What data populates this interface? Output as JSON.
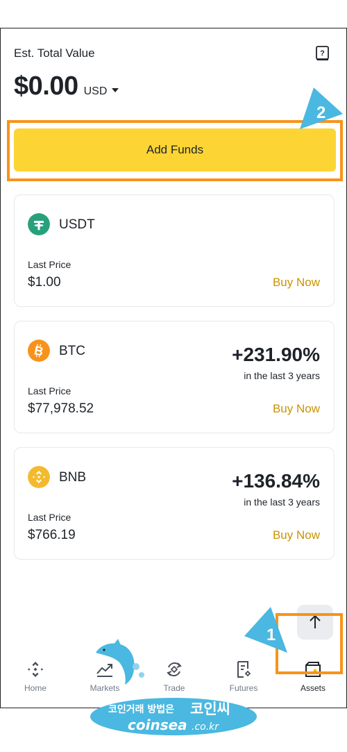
{
  "header": {
    "est_label": "Est. Total Value",
    "total_value": "$0.00",
    "currency": "USD"
  },
  "add_funds_label": "Add Funds",
  "coins": [
    {
      "name": "USDT",
      "last_label": "Last Price",
      "price": "$1.00",
      "buy_label": "Buy Now",
      "color": "#26a17b"
    },
    {
      "name": "BTC",
      "pct": "+231.90%",
      "pct_sub": "in the last 3 years",
      "last_label": "Last Price",
      "price": "$77,978.52",
      "buy_label": "Buy Now",
      "color": "#f7931a"
    },
    {
      "name": "BNB",
      "pct": "+136.84%",
      "pct_sub": "in the last 3 years",
      "last_label": "Last Price",
      "price": "$766.19",
      "buy_label": "Buy Now",
      "color": "#f3ba2f"
    }
  ],
  "nav": [
    {
      "label": "Home",
      "icon": "binance-logo-icon"
    },
    {
      "label": "Markets",
      "icon": "chart-trend-icon"
    },
    {
      "label": "Trade",
      "icon": "trade-swap-icon"
    },
    {
      "label": "Futures",
      "icon": "futures-doc-icon"
    },
    {
      "label": "Assets",
      "icon": "wallet-icon",
      "active": true
    }
  ],
  "annotations": {
    "step_1": "1",
    "step_2": "2",
    "accent_color": "#f7931a",
    "arrow_color": "#4ab8e0"
  },
  "watermark": {
    "line1": "코인거래 방법은",
    "brand_ko": "코인씨",
    "brand_en": "coinsea",
    "domain": ".co.kr"
  }
}
